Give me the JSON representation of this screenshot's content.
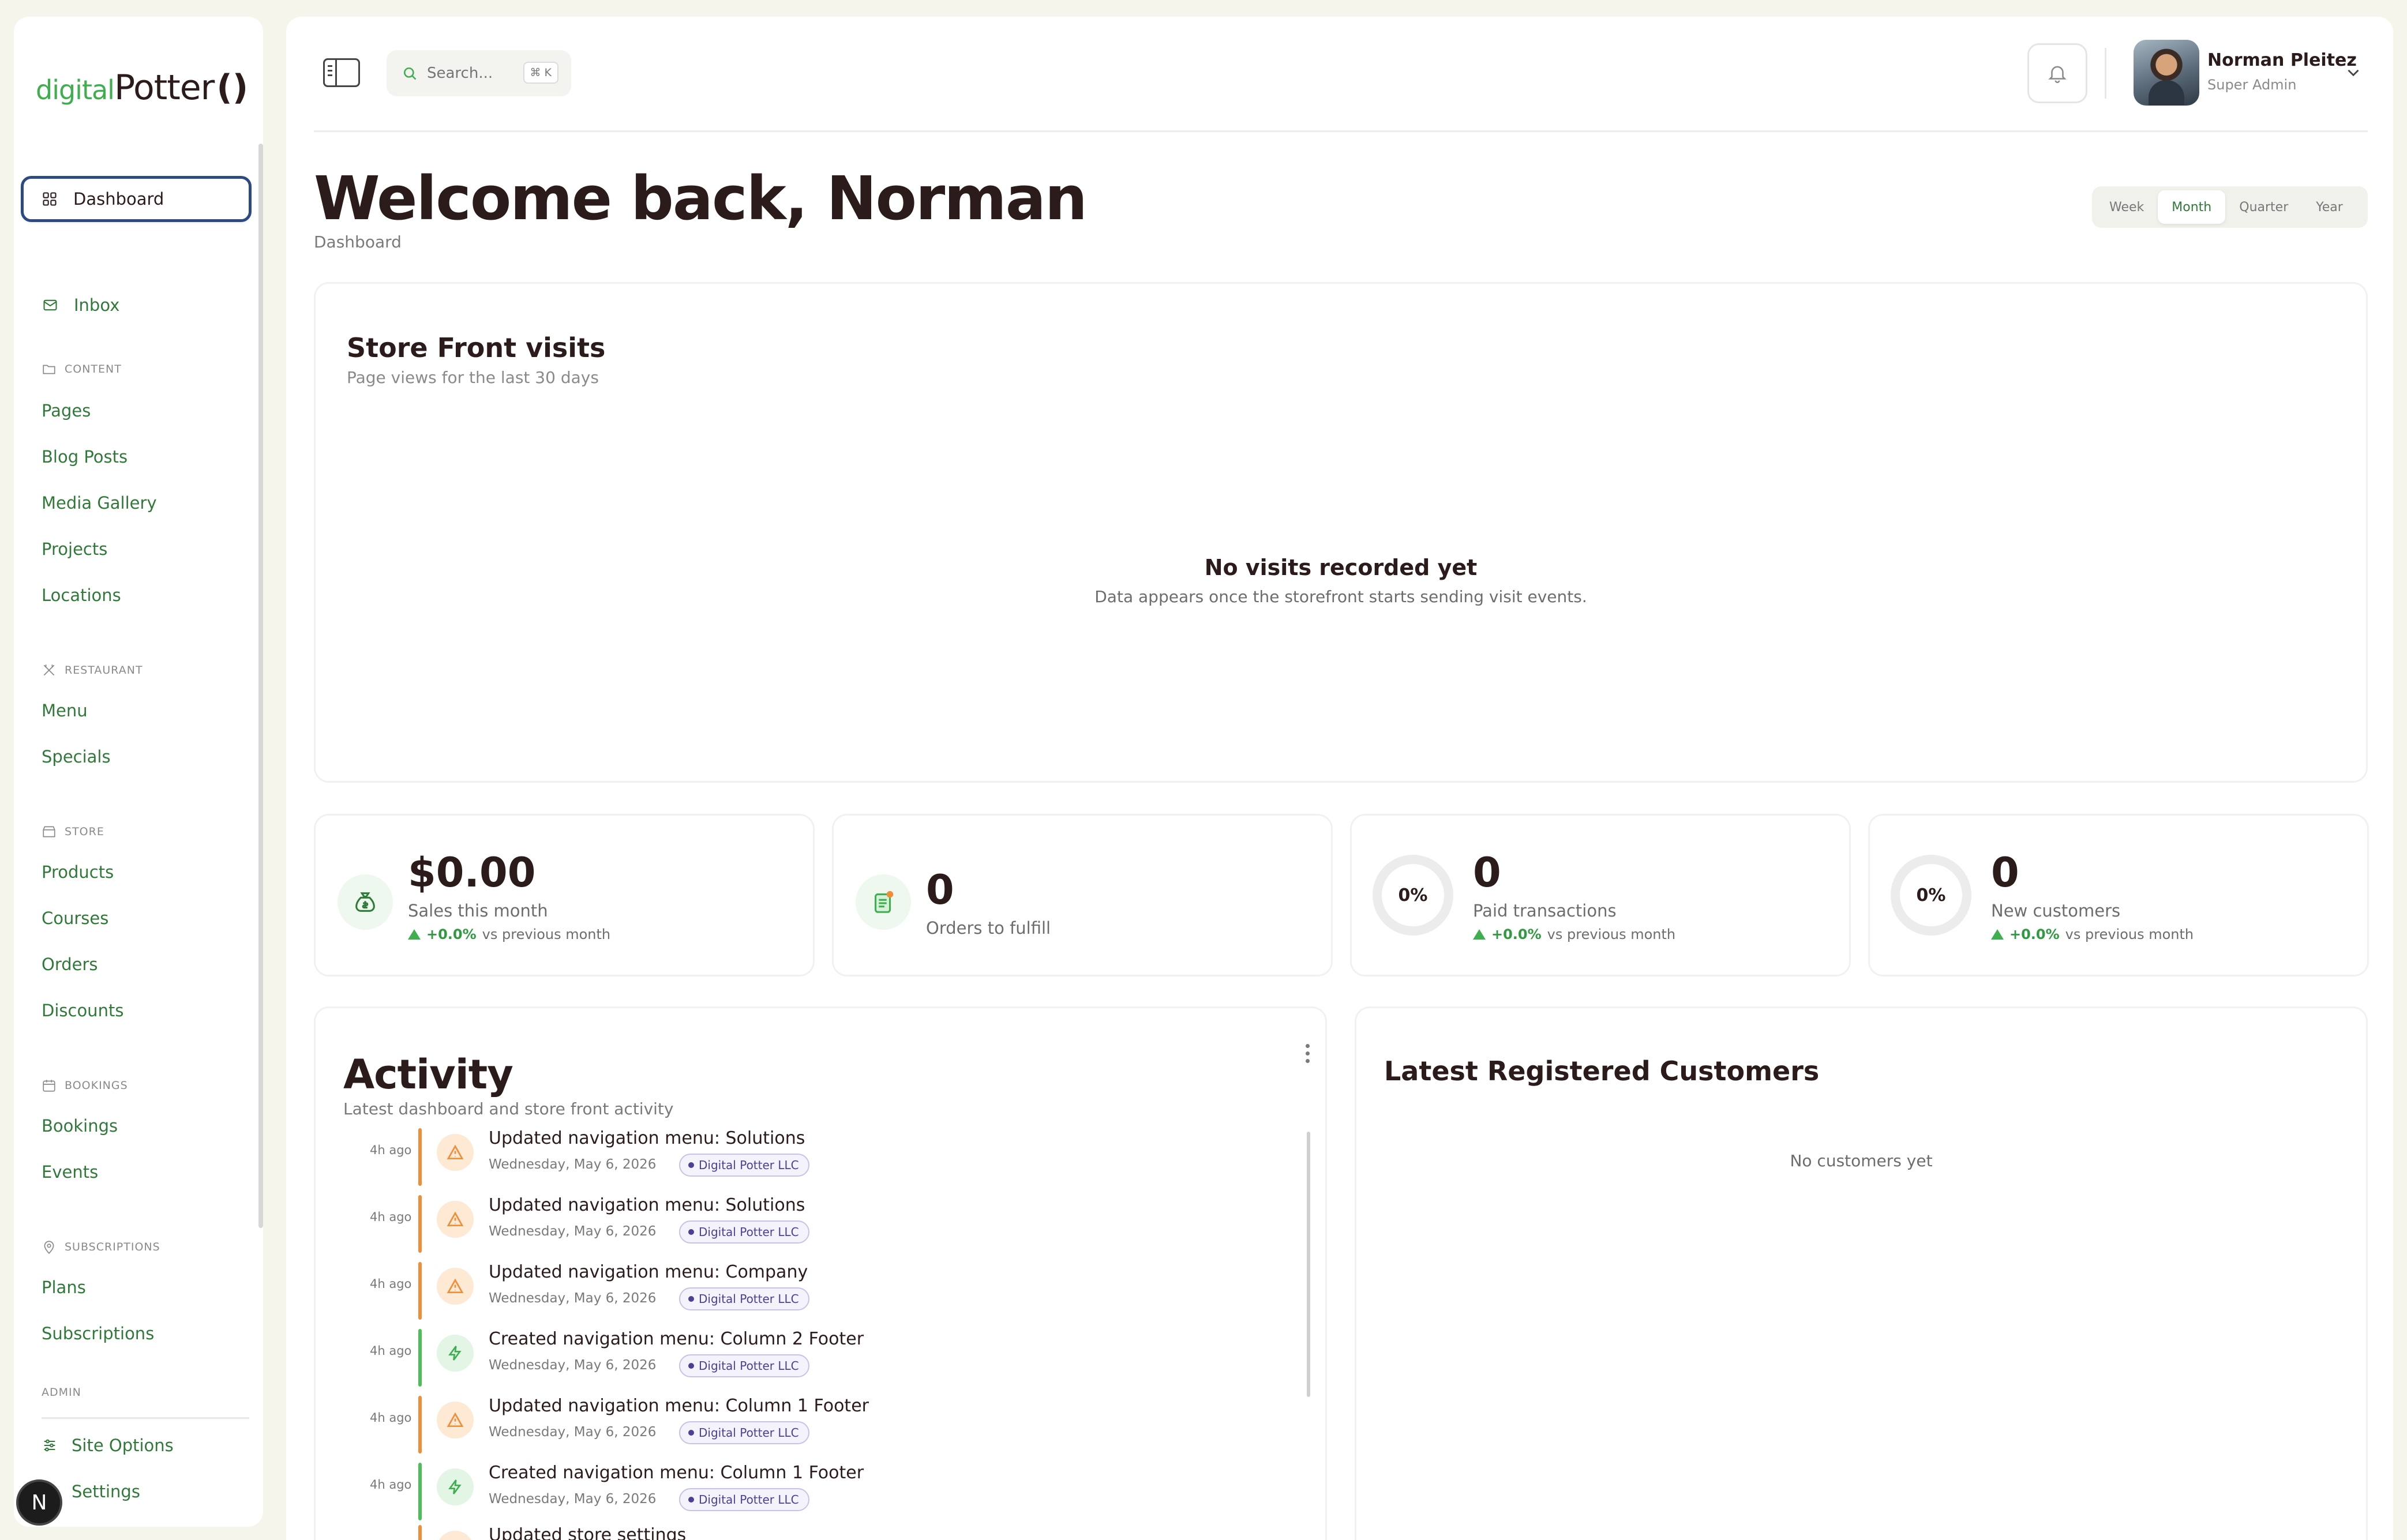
{
  "brand": {
    "part1": "digital",
    "part2": "Potter",
    "part3": "()"
  },
  "sidebar": {
    "active": {
      "label": "Dashboard",
      "icon": "grid-icon"
    },
    "inbox": {
      "label": "Inbox",
      "icon": "mail-icon"
    },
    "sections": {
      "content": {
        "label": "CONTENT",
        "icon": "folder-icon",
        "items": [
          "Pages",
          "Blog Posts",
          "Media Gallery",
          "Projects",
          "Locations"
        ]
      },
      "restaurant": {
        "label": "RESTAURANT",
        "icon": "utensils-icon",
        "items": [
          "Menu",
          "Specials"
        ]
      },
      "store": {
        "label": "STORE",
        "icon": "store-icon",
        "items": [
          "Products",
          "Courses",
          "Orders",
          "Discounts"
        ]
      },
      "bookings": {
        "label": "BOOKINGS",
        "icon": "calendar-icon",
        "items": [
          "Bookings",
          "Events"
        ]
      },
      "subscriptions": {
        "label": "SUBSCRIPTIONS",
        "icon": "pin-icon",
        "items": [
          "Plans",
          "Subscriptions"
        ]
      },
      "admin": {
        "label": "ADMIN",
        "items": [
          "Site Options",
          "Settings"
        ]
      }
    },
    "user_initial": "N"
  },
  "header": {
    "search_placeholder": "Search...",
    "search_shortcut": "⌘ K",
    "user_name": "Norman Pleitez",
    "user_role": "Super Admin"
  },
  "page": {
    "title": "Welcome back, Norman",
    "breadcrumb": "Dashboard",
    "periods": [
      "Week",
      "Month",
      "Quarter",
      "Year"
    ],
    "selected_period": "Month"
  },
  "visits": {
    "title": "Store Front visits",
    "subtitle": "Page views for the last 30 days",
    "empty_title": "No visits recorded yet",
    "empty_text": "Data appears once the storefront starts sending visit events."
  },
  "stats": [
    {
      "value": "$0.00",
      "label": "Sales this month",
      "change": "+0.0%",
      "suffix": "vs previous month"
    },
    {
      "value": "0",
      "label": "Orders to fulfill"
    },
    {
      "ring": "0%",
      "value": "0",
      "label": "Paid transactions",
      "change": "+0.0%",
      "suffix": "vs previous month"
    },
    {
      "ring": "0%",
      "value": "0",
      "label": "New customers",
      "change": "+0.0%",
      "suffix": "vs previous month"
    }
  ],
  "activity": {
    "title": "Activity",
    "subtitle": "Latest dashboard and store front activity",
    "items": [
      {
        "ago": "4h ago",
        "title": "Updated navigation menu: Solutions",
        "date": "Wednesday, May 6, 2026",
        "tag": "Digital Potter LLC",
        "kind": "warning"
      },
      {
        "ago": "4h ago",
        "title": "Updated navigation menu: Solutions",
        "date": "Wednesday, May 6, 2026",
        "tag": "Digital Potter LLC",
        "kind": "warning"
      },
      {
        "ago": "4h ago",
        "title": "Updated navigation menu: Company",
        "date": "Wednesday, May 6, 2026",
        "tag": "Digital Potter LLC",
        "kind": "warning"
      },
      {
        "ago": "4h ago",
        "title": "Created navigation menu: Column 2 Footer",
        "date": "Wednesday, May 6, 2026",
        "tag": "Digital Potter LLC",
        "kind": "created"
      },
      {
        "ago": "4h ago",
        "title": "Updated navigation menu: Column 1 Footer",
        "date": "Wednesday, May 6, 2026",
        "tag": "Digital Potter LLC",
        "kind": "warning"
      },
      {
        "ago": "4h ago",
        "title": "Created navigation menu: Column 1 Footer",
        "date": "Wednesday, May 6, 2026",
        "tag": "Digital Potter LLC",
        "kind": "created"
      },
      {
        "ago": "",
        "title": "Updated store settings",
        "date": "",
        "tag": "",
        "kind": "warning"
      }
    ]
  },
  "customers": {
    "title": "Latest Registered Customers",
    "empty": "No customers yet"
  },
  "colors": {
    "accent": "#3fae4f",
    "link": "#2f7a38",
    "warning": "#ef8e38",
    "active_border": "#2d4a82",
    "tag": "#4b3f96"
  }
}
